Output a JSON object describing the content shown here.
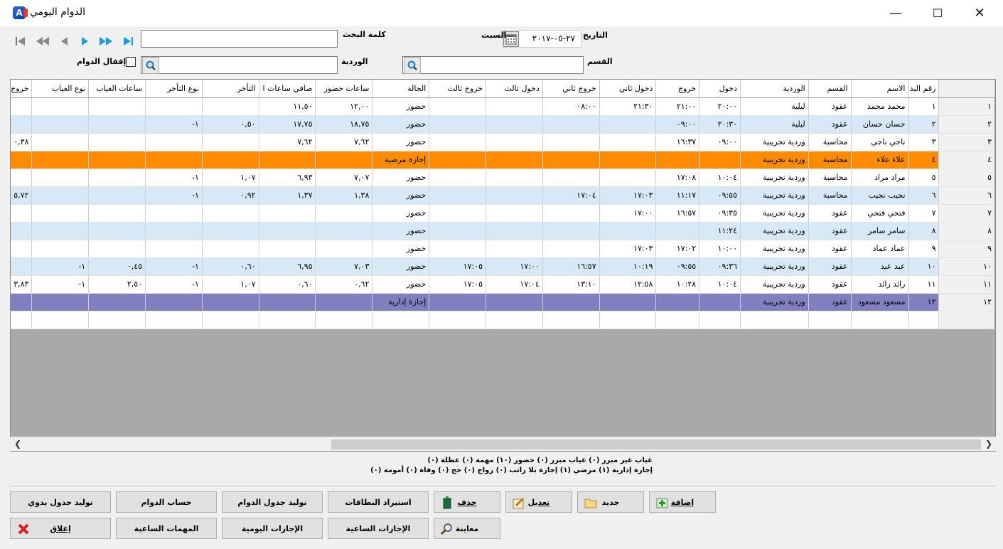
{
  "window": {
    "title": "الدوام اليومي",
    "minimize": "—",
    "maximize": "☐",
    "close": "✕"
  },
  "filters": {
    "search_label": "كلمة البحث",
    "date_label": "التاريخ",
    "date_value": "٢٧-٠٥-٢٠١٧",
    "day_name": "السبت",
    "shift_label": "الوردية",
    "dept_label": "القسم",
    "lock_label": "إقفال الدوام"
  },
  "table": {
    "columns": [
      "رقم البد",
      "الاسم",
      "القسم",
      "الوردية",
      "دخول",
      "خروج",
      "دخول ثاني",
      "خروج ثاني",
      "دخول ثالث",
      "خروج ثالث",
      "الحالة",
      "ساعات حضور",
      "صافي ساعات ا",
      "التأخر",
      "نوع التأخر",
      "ساعات الغياب",
      "نوع الغياب",
      "خروج"
    ],
    "rows": [
      {
        "rownum": "١",
        "style": "r-light",
        "cells": [
          "١",
          "محمد محمد",
          "عقود",
          "ليلية",
          "٢٠:٠٠",
          "٢١:٠٠",
          "٢١:٣٠",
          "٠٨:٠٠",
          "",
          "",
          "حضور",
          "١٢,٠٠",
          "١١,٥٠",
          "",
          "",
          "",
          "",
          ""
        ]
      },
      {
        "rownum": "٢",
        "style": "r-blue",
        "cells": [
          "٢",
          "حسان حسان",
          "عقود",
          "ليلية",
          "٢٠:٣٠",
          "٠٩:٠٠",
          "",
          "",
          "",
          "",
          "حضور",
          "١٨,٧٥",
          "١٧,٧٥",
          "٠,٥٠",
          "١-",
          "",
          "",
          ""
        ]
      },
      {
        "rownum": "٣",
        "style": "r-light",
        "cells": [
          "٣",
          "ناجي ناجي",
          "محاسبة",
          "وردية تجريبية",
          "٠٩:٠٠",
          "١٦:٣٧",
          "",
          "",
          "",
          "",
          "حضور",
          "٧,٦٢",
          "٧,٦٢",
          "",
          "",
          "",
          "",
          "٠,٣٨"
        ]
      },
      {
        "rownum": "٤",
        "style": "r-orange",
        "cells": [
          "٤",
          "علاء علاء",
          "محاسبة",
          "وردية تجريبية",
          "",
          "",
          "",
          "",
          "",
          "",
          "إجازة مرضية",
          "",
          "",
          "",
          "",
          "",
          "",
          ""
        ]
      },
      {
        "rownum": "٥",
        "style": "r-light",
        "cells": [
          "٥",
          "مراد مراد",
          "محاسبة",
          "وردية تجريبية",
          "١٠:٠٤",
          "١٧:٠٨",
          "",
          "",
          "",
          "",
          "حضور",
          "٧,٠٧",
          "٦,٩٣",
          "١,٠٧",
          "١-",
          "",
          "",
          ""
        ]
      },
      {
        "rownum": "٦",
        "style": "r-blue",
        "cells": [
          "٦",
          "نجيب نجيب",
          "محاسبة",
          "وردية تجريبية",
          "٠٩:٥٥",
          "١١:١٧",
          "١٧:٠٣",
          "١٧:٠٤",
          "",
          "",
          "حضور",
          "١,٣٨",
          "١,٣٧",
          "٠,٩٢",
          "١-",
          "",
          "",
          "٥,٧٢"
        ]
      },
      {
        "rownum": "٧",
        "style": "r-light",
        "cells": [
          "٧",
          "فتحي فتحي",
          "عقود",
          "وردية تجريبية",
          "٠٩:٣٥",
          "١٦:٥٧",
          "١٧:٠٠",
          "",
          "",
          "",
          "حضور",
          "",
          "",
          "",
          "",
          "",
          "",
          ""
        ]
      },
      {
        "rownum": "٨",
        "style": "r-blue",
        "cells": [
          "٨",
          "سامر سامر",
          "عقود",
          "وردية تجريبية",
          "١١:٢٤",
          "",
          "",
          "",
          "",
          "",
          "حضور",
          "",
          "",
          "",
          "",
          "",
          "",
          ""
        ]
      },
      {
        "rownum": "٩",
        "style": "r-light",
        "cells": [
          "٩",
          "عماد عماد",
          "عقود",
          "وردية تجريبية",
          "١٠:٠٠",
          "١٧:٠٢",
          "١٧:٠٣",
          "",
          "",
          "",
          "حضور",
          "",
          "",
          "",
          "",
          "",
          "",
          ""
        ]
      },
      {
        "rownum": "١٠",
        "style": "r-blue",
        "cells": [
          "١٠",
          "عبد عبد",
          "عقود",
          "وردية تجريبية",
          "٠٩:٣٦",
          "٠٩:٥٥",
          "١٠:١٩",
          "١٦:٥٧",
          "١٧:٠٠",
          "١٧:٠٥",
          "حضور",
          "٧,٠٣",
          "٦,٩٥",
          "٠,٦٠",
          "١-",
          "٠,٤٥",
          "١-",
          ""
        ]
      },
      {
        "rownum": "١١",
        "style": "r-light",
        "cells": [
          "١١",
          "رائد رائد",
          "عقود",
          "وردية تجريبية",
          "١٠:٠٤",
          "١٠:٢٨",
          "١٢:٥٨",
          "١٣:١٠",
          "١٧:٠٤",
          "١٧:٠٥",
          "حضور",
          "٠,٦٢",
          "٠,٦٠",
          "١,٠٧",
          "١-",
          "٢,٥٠",
          "١-",
          "٣,٨٣"
        ]
      },
      {
        "rownum": "١٢",
        "style": "r-purple",
        "cells": [
          "١٢",
          "مسعود مسعود",
          "عقود",
          "وردية تجريبية",
          "",
          "",
          "",
          "",
          "",
          "",
          "إجازة إدارية",
          "",
          "",
          "",
          "",
          "",
          "",
          ""
        ]
      }
    ]
  },
  "legend": {
    "line1": "غياب غير مبرر (٠)   غياب مبرر (٠)   حضور (١٠)   مهمة (٠)   عطلة (٠)",
    "line2": "إجازة إدارية (١)   مرضي (١)   إجازة بلا راتب (٠)   زواج (٠)   حج (٠)   وفاة (٠)   أمومة (٠)"
  },
  "buttons": {
    "add": "إضافة",
    "new": "جديد",
    "edit": "تعديل",
    "delete": "حذف",
    "import_cards": "استيراد البطاقات",
    "gen_schedule": "توليد جدول الدوام",
    "calc": "حساب الدوام",
    "gen_manual": "توليد جدول يدوي",
    "preview": "معاينة",
    "hourly_leaves": "الإجازات الساعية",
    "daily_leaves": "الإجازات اليومية",
    "hourly_tasks": "المهمات الساعية",
    "close": "إغلاق"
  }
}
